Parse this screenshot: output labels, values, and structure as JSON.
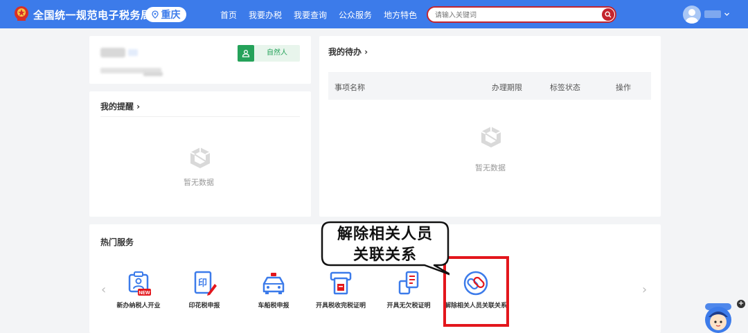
{
  "header": {
    "site_title": "全国统一规范电子税务局",
    "region": "重庆",
    "nav": [
      "首页",
      "我要办税",
      "我要查询",
      "公众服务",
      "地方特色"
    ],
    "search_placeholder": "请输入关键词",
    "brand_color": "#3c7bea",
    "search_border_color": "#c4252e"
  },
  "user_card": {
    "taxpayer_type": "自然人",
    "tag_color": "#25a25a"
  },
  "reminders": {
    "title": "我的提醒 ›",
    "empty_text": "暂无数据"
  },
  "todo": {
    "title": "我的待办 ›",
    "columns": [
      "事项名称",
      "办理期限",
      "标签状态",
      "操作"
    ],
    "empty_text": "暂无数据"
  },
  "hot_services": {
    "title": "热门服务",
    "prev_arrow": "‹",
    "next_arrow": "›",
    "items": [
      {
        "label": "新办纳税人开业",
        "icon": "new-taxpayer-icon",
        "badge": "NEW"
      },
      {
        "label": "印花税申报",
        "icon": "stamp-tax-icon"
      },
      {
        "label": "车船税申报",
        "icon": "vehicle-tax-icon"
      },
      {
        "label": "开具税收完税证明",
        "icon": "tax-certificate-icon"
      },
      {
        "label": "开具无欠税证明",
        "icon": "no-arrears-certificate-icon"
      },
      {
        "label": "解除相关人员关联关系",
        "icon": "unlink-icon"
      }
    ],
    "highlight_color": "#e3161c"
  },
  "callout": {
    "line1": "解除相关人员",
    "line2": "关联关系"
  },
  "assistant": {
    "plus": "+"
  }
}
